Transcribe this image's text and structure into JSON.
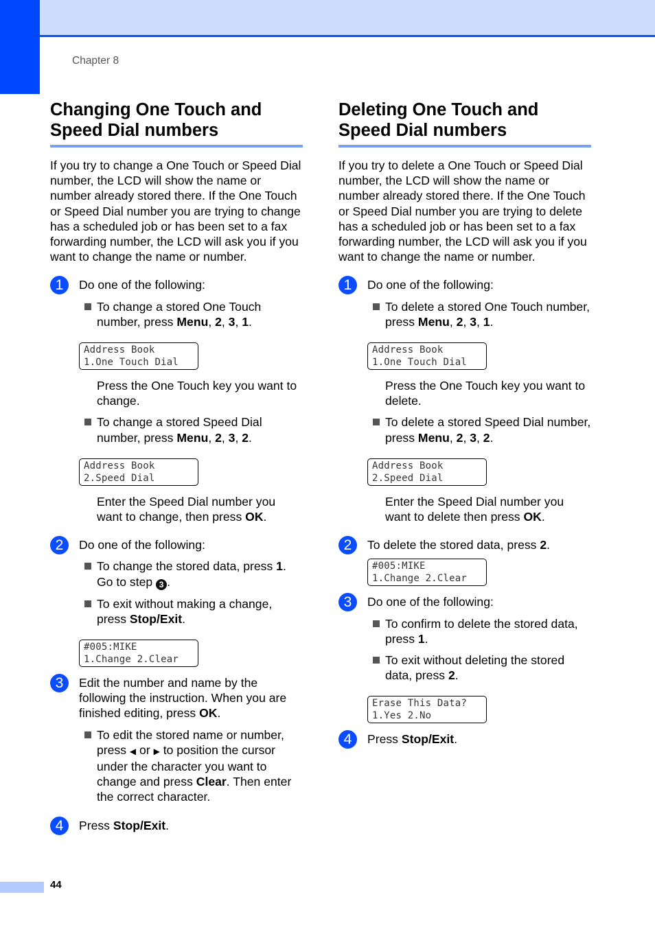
{
  "header": {
    "chapter": "Chapter 8"
  },
  "footer": {
    "page_number": "44"
  },
  "colors": {
    "accent_blue": "#0048ff",
    "band_light": "#ccdcfc",
    "heading_rule": "#7aa0f0",
    "footer_tab": "#b3caff"
  },
  "left": {
    "title_line1": "Changing One Touch and",
    "title_line2": "Speed Dial numbers",
    "intro": "If you try to change a One Touch or Speed Dial number, the LCD will show the name or number already stored there. If the One Touch or Speed Dial number you are trying to change has a scheduled job or has been set to a fax forwarding number, the LCD will ask you if you want to change the name or number.",
    "step1": {
      "num": "1",
      "text": "Do one of the following:",
      "b1_pre": "To change a stored One Touch number, press ",
      "b1_keys": [
        "Menu",
        "2",
        "3",
        "1"
      ],
      "lcd1": [
        "Address Book",
        "1.One Touch Dial"
      ],
      "note1": "Press the One Touch key you want to change.",
      "b2_pre": "To change a stored Speed Dial number, press ",
      "b2_keys": [
        "Menu",
        "2",
        "3",
        "2"
      ],
      "lcd2": [
        "Address Book",
        "2.Speed Dial"
      ],
      "note2_pre": "Enter the Speed Dial number you want to change, then press ",
      "note2_key": "OK"
    },
    "step2": {
      "num": "2",
      "text": "Do one of the following:",
      "b1_pre": "To change the stored data, press ",
      "b1_key": "1",
      "b1_mid": ". Go to step ",
      "b1_ref": "3",
      "b2_pre": "To exit without making a change, press ",
      "b2_key": "Stop/Exit",
      "lcd": [
        "#005:MIKE",
        "1.Change 2.Clear"
      ]
    },
    "step3": {
      "num": "3",
      "text_pre": "Edit the number and name by the following the instruction. When you are finished editing, press ",
      "text_key": "OK",
      "b1_a": "To edit the stored name or number, press ",
      "left_arrow": "◀",
      "b1_or": " or ",
      "right_arrow": "▶",
      "b1_b": " to position the cursor under the character you want to change and press ",
      "b1_key": "Clear",
      "b1_c": ". Then enter the correct character."
    },
    "step4": {
      "num": "4",
      "text_pre": "Press ",
      "key": "Stop/Exit"
    }
  },
  "right": {
    "title_line1": "Deleting One Touch and",
    "title_line2": "Speed Dial numbers",
    "intro": "If you try to delete a One Touch or Speed Dial number, the LCD will show the name or number already stored there. If the One Touch or Speed Dial number you are trying to delete has a scheduled job or has been set to a fax forwarding number, the LCD will ask you if you want to change the name or number.",
    "step1": {
      "num": "1",
      "text": "Do one of the following:",
      "b1_pre": "To delete a stored One Touch number, press ",
      "b1_keys": [
        "Menu",
        "2",
        "3",
        "1"
      ],
      "lcd1": [
        "Address Book",
        "1.One Touch Dial"
      ],
      "note1": "Press the One Touch key you want to delete.",
      "b2_pre": "To delete a stored Speed Dial number, press ",
      "b2_keys": [
        "Menu",
        "2",
        "3",
        "2"
      ],
      "lcd2": [
        "Address Book",
        "2.Speed Dial"
      ],
      "note2_pre": "Enter the Speed Dial number you want to delete then press ",
      "note2_key": "OK"
    },
    "step2": {
      "num": "2",
      "text_pre": "To delete the stored data, press ",
      "key": "2",
      "lcd": [
        "#005:MIKE",
        "1.Change 2.Clear"
      ]
    },
    "step3": {
      "num": "3",
      "text": "Do one of the following:",
      "b1_pre": "To confirm to delete the stored data, press ",
      "b1_key": "1",
      "b2_pre": "To exit without deleting the stored data, press ",
      "b2_key": "2",
      "lcd": [
        "Erase This Data?",
        "1.Yes 2.No"
      ]
    },
    "step4": {
      "num": "4",
      "text_pre": "Press ",
      "key": "Stop/Exit"
    }
  }
}
